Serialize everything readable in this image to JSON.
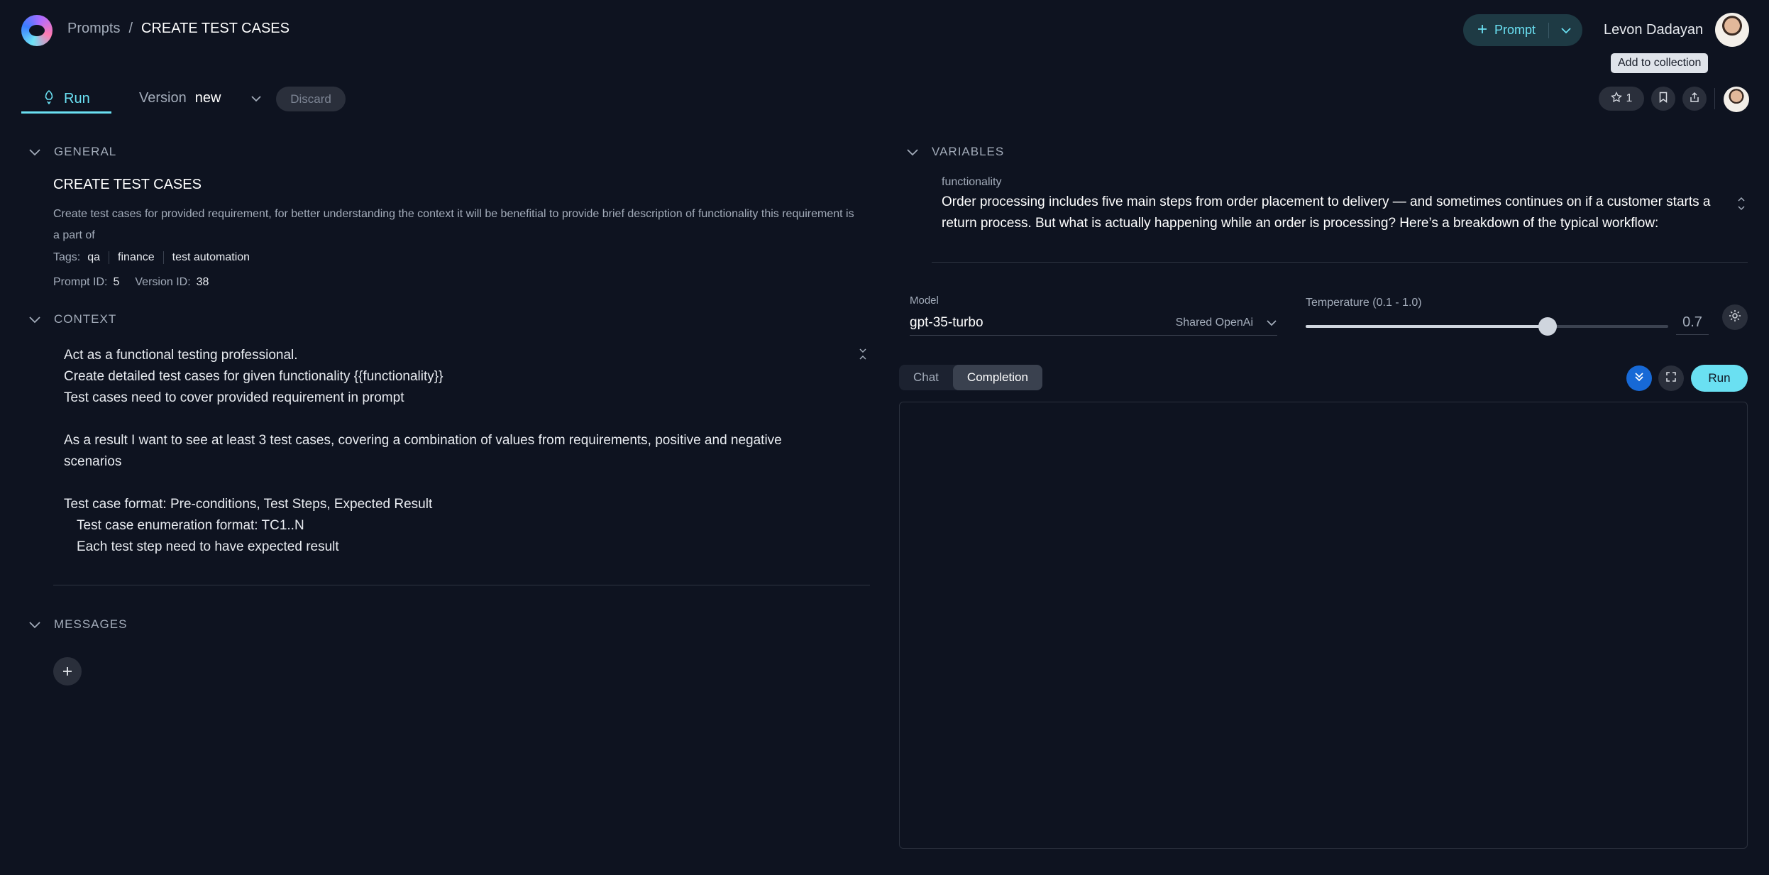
{
  "header": {
    "breadcrumb": {
      "root": "Prompts",
      "separator": "/",
      "current": "CREATE TEST CASES"
    },
    "prompt_button_label": "Prompt",
    "user_name": "Levon Dadayan",
    "tooltip": "Add to collection"
  },
  "toolbar": {
    "run_tab": "Run",
    "version_label": "Version",
    "version_value": "new",
    "discard_label": "Discard",
    "star_count": "1"
  },
  "general": {
    "section_label": "GENERAL",
    "title": "CREATE TEST CASES",
    "description": "Create test cases for provided requirement, for better understanding the context it will be benefitial to provide brief description of functionality this requirement is a part of",
    "tags_label": "Tags:",
    "tags": [
      "qa",
      "finance",
      "test automation"
    ],
    "prompt_id_label": "Prompt ID:",
    "prompt_id": "5",
    "version_id_label": "Version ID:",
    "version_id": "38"
  },
  "context": {
    "section_label": "CONTEXT",
    "lines": [
      "Act as a functional testing professional.",
      "Create detailed test cases for given functionality {{functionality}}",
      "Test cases need to cover provided requirement in prompt",
      "",
      "As a result I want to see at least 3 test cases, covering a combination of values from requirements, positive and negative",
      "scenarios",
      "",
      "Test case format: Pre-conditions, Test Steps, Expected Result",
      "    Test case enumeration format: TC1..N",
      "    Each test step need to have expected result"
    ]
  },
  "messages": {
    "section_label": "MESSAGES"
  },
  "variables": {
    "section_label": "VARIABLES",
    "name": "functionality",
    "value": "Order processing includes five main steps from order placement to delivery — and sometimes continues on if a customer starts a return process. But what is actually happening while an order is processing? Here’s a breakdown of the typical workflow:"
  },
  "model": {
    "label": "Model",
    "name": "gpt-35-turbo",
    "provider": "Shared OpenAi",
    "temperature_label": "Temperature (0.1 - 1.0)",
    "temperature_value": "0.7",
    "temperature_fraction": 0.667
  },
  "output": {
    "tabs": [
      "Chat",
      "Completion"
    ],
    "active_tab": "Completion",
    "run_label": "Run"
  },
  "colors": {
    "accent": "#6ae0f2",
    "background": "#0e1320",
    "scroll_button": "#1769d6"
  }
}
